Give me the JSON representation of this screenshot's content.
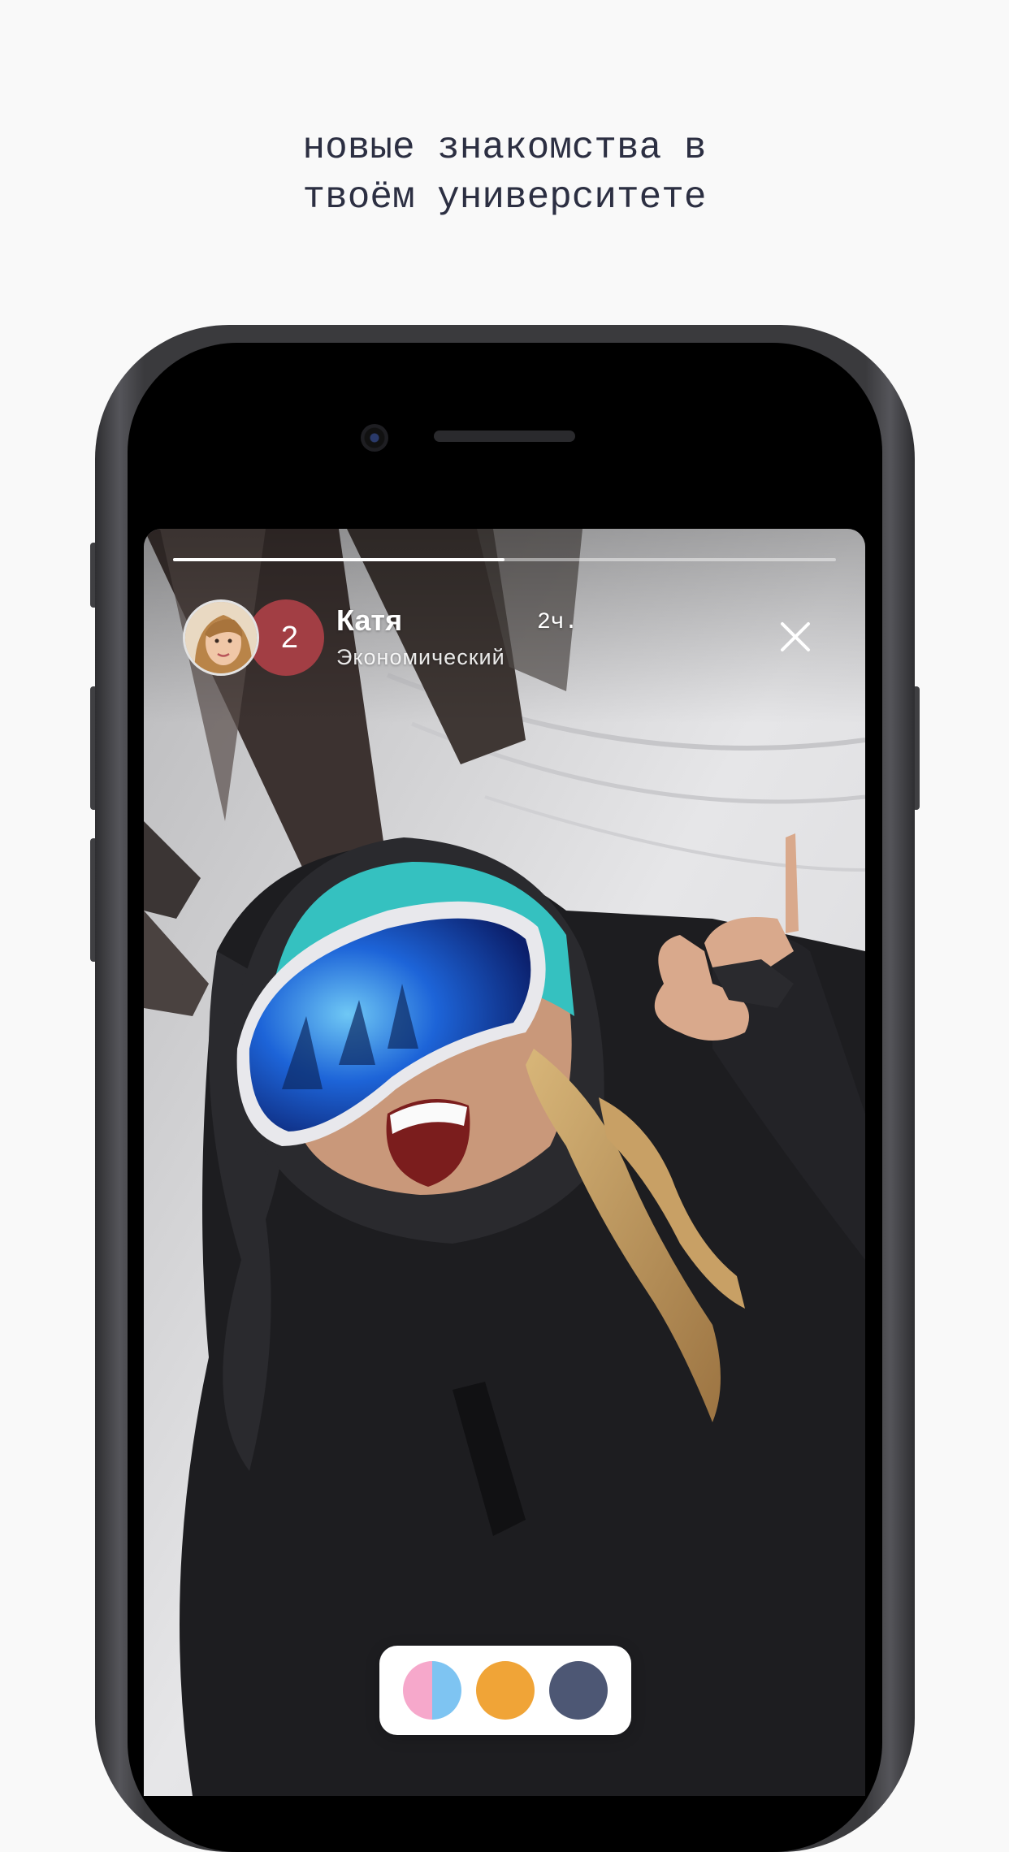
{
  "headline": {
    "line1": "новые знакомства в",
    "line2": "твоём университете"
  },
  "story": {
    "progress_fraction": 0.5,
    "unread_count": "2",
    "user_name": "Катя",
    "faculty": "Экономический",
    "time_ago": "2ч.",
    "photo": "snowboarder-selfie-with-ski-goggles"
  },
  "reactions": [
    {
      "name": "split-pink-blue",
      "colors": [
        "#f6a8cb",
        "#7ec4f2"
      ]
    },
    {
      "name": "orange",
      "colors": [
        "#f0a437"
      ]
    },
    {
      "name": "slate",
      "colors": [
        "#4d5774"
      ]
    }
  ],
  "colors": {
    "background": "#f9f9f9",
    "headline_text": "#2c2f42",
    "badge": "#a23e44"
  }
}
